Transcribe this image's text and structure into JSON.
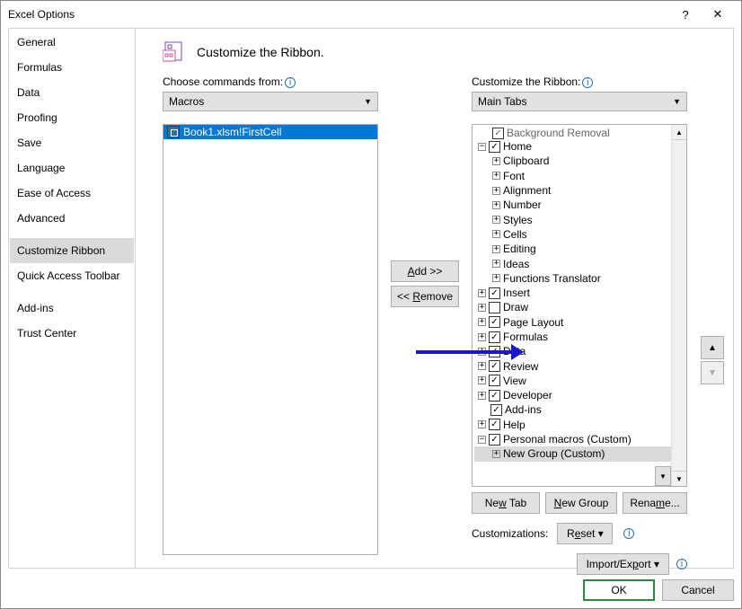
{
  "titlebar": {
    "title": "Excel Options",
    "help": "?",
    "close": "✕"
  },
  "sidebar": {
    "items": [
      "General",
      "Formulas",
      "Data",
      "Proofing",
      "Save",
      "Language",
      "Ease of Access",
      "Advanced",
      "Customize Ribbon",
      "Quick Access Toolbar",
      "Add-ins",
      "Trust Center"
    ],
    "selected_index": 8
  },
  "header": {
    "text": "Customize the Ribbon."
  },
  "left": {
    "label": "Choose commands from:",
    "combo": "Macros",
    "list": [
      "Book1.xlsm!FirstCell"
    ]
  },
  "mid": {
    "add": "Add >>",
    "remove": "<< Remove"
  },
  "right": {
    "label": "Customize the Ribbon:",
    "combo": "Main Tabs",
    "tree": [
      {
        "ind": 1,
        "exp": "",
        "chk": "✓",
        "label": "Background Removal",
        "cut": true
      },
      {
        "ind": 0,
        "exp": "−",
        "chk": "✓",
        "label": "Home"
      },
      {
        "ind": 1,
        "exp": "+",
        "chk": "",
        "label": "Clipboard",
        "plain": true
      },
      {
        "ind": 1,
        "exp": "+",
        "chk": "",
        "label": "Font",
        "plain": true
      },
      {
        "ind": 1,
        "exp": "+",
        "chk": "",
        "label": "Alignment",
        "plain": true
      },
      {
        "ind": 1,
        "exp": "+",
        "chk": "",
        "label": "Number",
        "plain": true
      },
      {
        "ind": 1,
        "exp": "+",
        "chk": "",
        "label": "Styles",
        "plain": true
      },
      {
        "ind": 1,
        "exp": "+",
        "chk": "",
        "label": "Cells",
        "plain": true
      },
      {
        "ind": 1,
        "exp": "+",
        "chk": "",
        "label": "Editing",
        "plain": true
      },
      {
        "ind": 1,
        "exp": "+",
        "chk": "",
        "label": "Ideas",
        "plain": true
      },
      {
        "ind": 1,
        "exp": "+",
        "chk": "",
        "label": "Functions Translator",
        "plain": true
      },
      {
        "ind": 0,
        "exp": "+",
        "chk": "✓",
        "label": "Insert"
      },
      {
        "ind": 0,
        "exp": "+",
        "chk": "",
        "label": "Draw"
      },
      {
        "ind": 0,
        "exp": "+",
        "chk": "✓",
        "label": "Page Layout"
      },
      {
        "ind": 0,
        "exp": "+",
        "chk": "✓",
        "label": "Formulas"
      },
      {
        "ind": 0,
        "exp": "+",
        "chk": "✓",
        "label": "Data"
      },
      {
        "ind": 0,
        "exp": "+",
        "chk": "✓",
        "label": "Review"
      },
      {
        "ind": 0,
        "exp": "+",
        "chk": "✓",
        "label": "View"
      },
      {
        "ind": 0,
        "exp": "+",
        "chk": "✓",
        "label": "Developer"
      },
      {
        "ind": 0,
        "exp": "",
        "chk": "✓",
        "label": "Add-ins",
        "noexp": true
      },
      {
        "ind": 0,
        "exp": "+",
        "chk": "✓",
        "label": "Help"
      },
      {
        "ind": 0,
        "exp": "−",
        "chk": "✓",
        "label": "Personal macros (Custom)"
      },
      {
        "ind": 1,
        "exp": "+",
        "chk": "",
        "label": "New Group (Custom)",
        "plain": true,
        "sel": true
      }
    ],
    "buttons": {
      "newtab": "New Tab",
      "newgroup": "New Group",
      "rename": "Rename..."
    },
    "cust_label": "Customizations:",
    "reset": "Reset",
    "importexport": "Import/Export"
  },
  "footer": {
    "ok": "OK",
    "cancel": "Cancel"
  }
}
